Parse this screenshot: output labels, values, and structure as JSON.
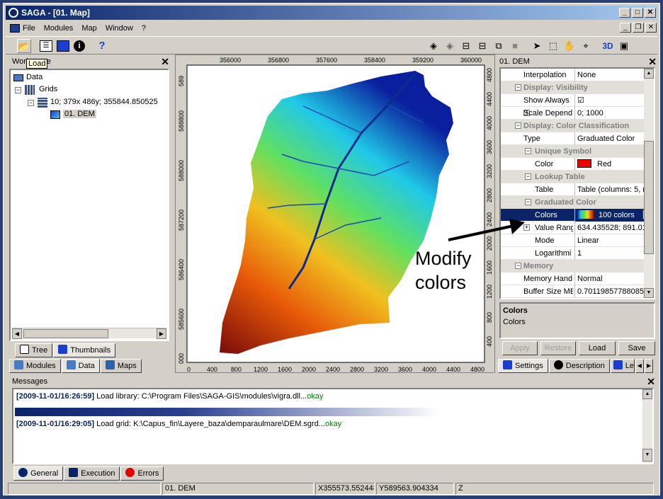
{
  "window": {
    "title": "SAGA - [01. Map]"
  },
  "menu": [
    "File",
    "Modules",
    "Map",
    "Window",
    "?"
  ],
  "tooltip": "Load",
  "workspace": {
    "title": "Workspace",
    "tree": {
      "root": "Data",
      "grids": "Grids",
      "system": "10; 379x 486y; 355844.850525",
      "item": "01. DEM"
    },
    "subtabs": [
      "Tree",
      "Thumbnails"
    ],
    "tabs": [
      "Modules",
      "Data",
      "Maps"
    ]
  },
  "map": {
    "x_ticks_top": [
      "356000",
      "356800",
      "357600",
      "358400",
      "359200",
      "360000"
    ],
    "y_ticks_left": [
      "588800",
      "588000",
      "587200",
      "586400",
      "585600"
    ],
    "x_ticks_bottom": [
      "0",
      "400",
      "800",
      "1200",
      "1600",
      "2000",
      "2400",
      "2800",
      "3200",
      "3600",
      "4000",
      "4400",
      "4800"
    ],
    "y_ticks_right": [
      "4400",
      "4000",
      "3600",
      "3200",
      "2800",
      "2400",
      "2000",
      "1600",
      "1200",
      "800",
      "400"
    ],
    "y_left_top_partial": "589",
    "y_left_bottom_partial": "000",
    "y_right_top_partial": "4800",
    "annotation_line1": "Modify",
    "annotation_line2": "colors",
    "colors": {
      "low": "#0a1f9e",
      "mid": "#20c8e8",
      "high": "#e85a08",
      "peak": "#7a0a0a"
    }
  },
  "properties": {
    "title": "01. DEM",
    "rows": [
      {
        "type": "row",
        "key": "Interpolation",
        "value": "None"
      },
      {
        "type": "group",
        "key": "Display: Visibility",
        "toggle": "⊟"
      },
      {
        "type": "row",
        "key": "Show Always",
        "value": "☑"
      },
      {
        "type": "row",
        "key": "Scale Depend",
        "value": "0; 1000",
        "toggle": "⊞"
      },
      {
        "type": "group",
        "key": "Display: Color Classification",
        "toggle": "⊟"
      },
      {
        "type": "row",
        "key": "Type",
        "value": "Graduated Color"
      },
      {
        "type": "group",
        "key": "Unique Symbol",
        "toggle": "⊟",
        "indent": true
      },
      {
        "type": "row",
        "key": "Color",
        "value": "Red",
        "swatch": "#ee0000",
        "indent": true
      },
      {
        "type": "group",
        "key": "Lookup Table",
        "toggle": "⊟",
        "indent": true
      },
      {
        "type": "row",
        "key": "Table",
        "value": "Table (columns: 5, r",
        "indent": true
      },
      {
        "type": "group",
        "key": "Graduated Color",
        "toggle": "⊟",
        "indent": true
      },
      {
        "type": "row",
        "key": "Colors",
        "value": "100 colors",
        "selected": true,
        "indent": true
      },
      {
        "type": "row",
        "key": "Value Rang",
        "value": "634.435528; 891.01",
        "toggle": "⊞",
        "indent": true
      },
      {
        "type": "row",
        "key": "Mode",
        "value": "Linear",
        "indent": true
      },
      {
        "type": "row",
        "key": "Logarithmi",
        "value": "1",
        "indent": true
      },
      {
        "type": "group",
        "key": "Memory",
        "toggle": "⊟"
      },
      {
        "type": "row",
        "key": "Memory Hand",
        "value": "Normal"
      },
      {
        "type": "row",
        "key": "Buffer Size ME",
        "value": "0.701198577880859"
      }
    ],
    "desc_title": "Colors",
    "desc_text": "Colors",
    "buttons": [
      "Apply",
      "Restore",
      "Load",
      "Save"
    ],
    "tabs": [
      "Settings",
      "Description",
      "Le"
    ]
  },
  "messages": {
    "title": "Messages",
    "line1_ts": "[2009-11-01/16:26:59]",
    "line1_text": " Load library: C:\\Program Files\\SAGA-GIS\\modules\\vigra.dll...",
    "line1_ok": "okay",
    "line2_ts": "[2009-11-01/16:29:05]",
    "line2_text": " Load grid: K:\\Capus_fin\\Layere_baza\\demparaulmare\\DEM.sgrd...",
    "line2_ok": "okay",
    "tabs": [
      "General",
      "Execution",
      "Errors"
    ]
  },
  "status": {
    "layer": "01. DEM",
    "x": "X355573.552448",
    "y": "Y589563.904334",
    "z": "Z"
  }
}
